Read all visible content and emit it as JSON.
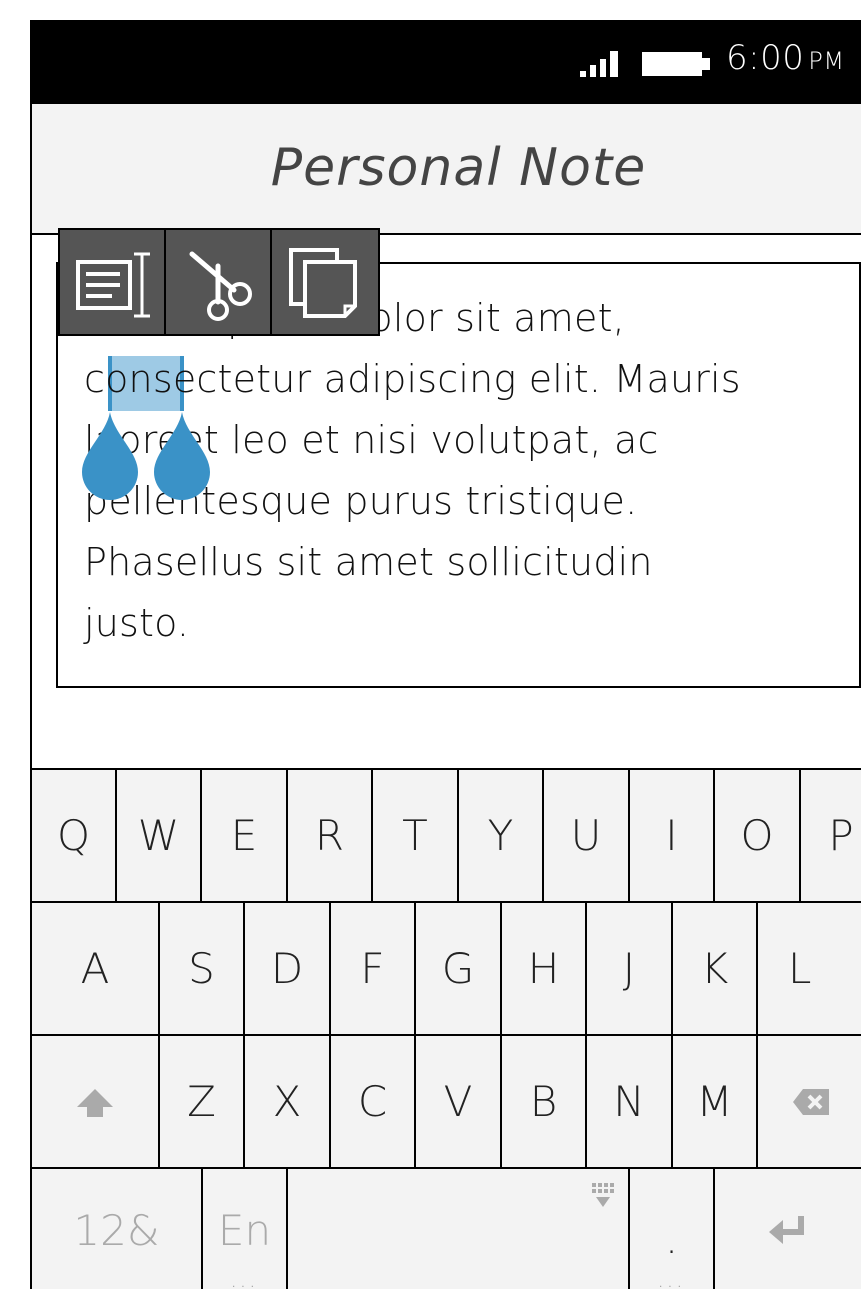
{
  "status_bar": {
    "time": "6:00",
    "ampm": "PM",
    "signal_icon": "signal-icon",
    "battery_icon": "battery-icon"
  },
  "header": {
    "title": "Personal Note"
  },
  "note": {
    "text": "Lorem ipsum dolor sit amet,\nconsectetur adipiscing elit. Mauris\nlaoreet leo et nisi volutpat, ac\npellentesque purus tristique.\nPhasellus sit amet sollicitudin\njusto.",
    "selected_text": "ons",
    "selection_color": "#4e9fd0"
  },
  "context_menu": {
    "items": [
      {
        "name": "select-all",
        "icon": "select-all-icon"
      },
      {
        "name": "cut",
        "icon": "scissors-icon"
      },
      {
        "name": "copy",
        "icon": "copy-icon"
      }
    ]
  },
  "keyboard": {
    "row1": [
      "Q",
      "W",
      "E",
      "R",
      "T",
      "Y",
      "U",
      "I",
      "O",
      "P"
    ],
    "row2": [
      "A",
      "S",
      "D",
      "F",
      "G",
      "H",
      "J",
      "K",
      "L"
    ],
    "row3": [
      "Z",
      "X",
      "C",
      "V",
      "B",
      "N",
      "M"
    ],
    "numbers_label": "12&",
    "language_label": "En",
    "period_label": ".",
    "shift_icon": "shift-icon",
    "backspace_icon": "backspace-icon",
    "enter_icon": "enter-icon",
    "hide_keyboard_icon": "hide-keyboard-icon"
  }
}
